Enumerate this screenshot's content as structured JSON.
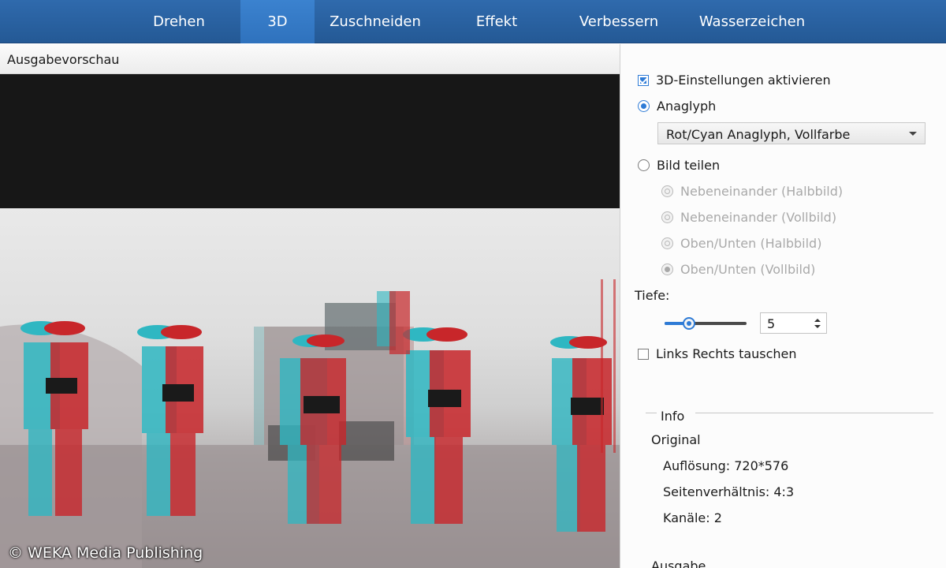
{
  "tabs": [
    {
      "label": "Drehen",
      "active": false
    },
    {
      "label": "3D",
      "active": true
    },
    {
      "label": "Zuschneiden",
      "active": false
    },
    {
      "label": "Effekt",
      "active": false
    },
    {
      "label": "Verbessern",
      "active": false
    },
    {
      "label": "Wasserzeichen",
      "active": false
    }
  ],
  "preview": {
    "title": "Ausgabevorschau",
    "watermark": "© WEKA Media Publishing"
  },
  "settings": {
    "enable_3d_label": "3D-Einstellungen aktivieren",
    "enable_3d_checked": true,
    "anaglyph_label": "Anaglyph",
    "anaglyph_selected": true,
    "anaglyph_option": "Rot/Cyan Anaglyph, Vollfarbe",
    "split_label": "Bild teilen",
    "split_selected": false,
    "split_options": [
      "Nebeneinander (Halbbild)",
      "Nebeneinander (Vollbild)",
      "Oben/Unten (Halbbild)",
      "Oben/Unten (Vollbild)"
    ],
    "depth_label": "Tiefe:",
    "depth_value": "5",
    "depth_slider_fraction": 0.3,
    "swap_label": "Links Rechts tauschen",
    "swap_checked": false
  },
  "info": {
    "title": "Info",
    "original_heading": "Original",
    "resolution": "Auflösung: 720*576",
    "aspect": "Seitenverhältnis: 4:3",
    "channels": "Kanäle: 2",
    "output_heading": "Ausgabe"
  },
  "colors": {
    "accent": "#2e7bd6",
    "tabbar": "#2a64a6",
    "anaglyph_red": "#c8262a",
    "anaglyph_cyan": "#2fb7c2"
  }
}
